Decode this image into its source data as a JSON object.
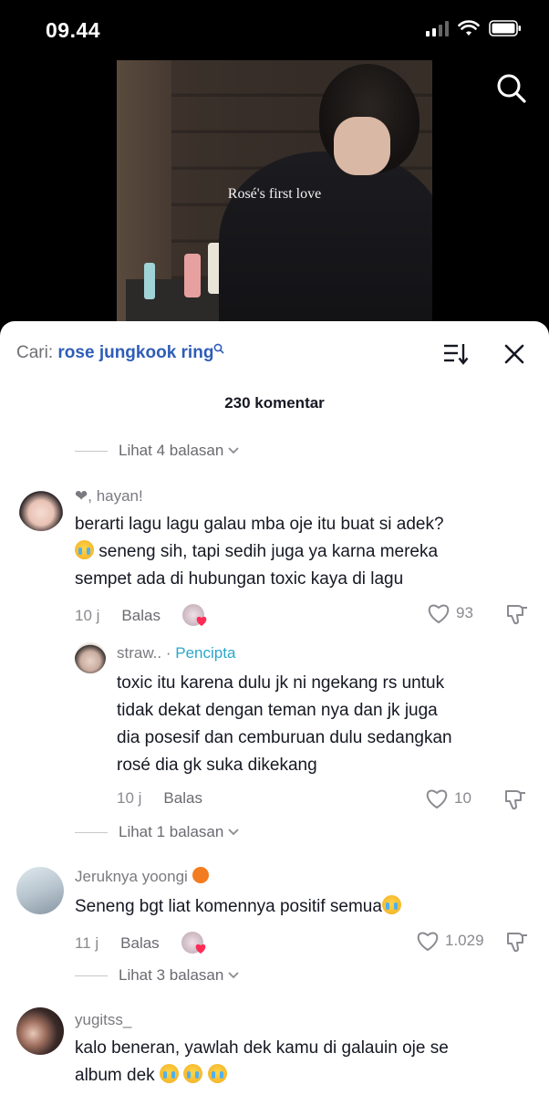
{
  "status_bar": {
    "time": "09.44"
  },
  "video": {
    "caption": "Rosé's first love"
  },
  "sheet": {
    "search_prefix": "Cari:",
    "search_query": "rose jungkook ring",
    "comment_count": "230 komentar"
  },
  "comments": [
    {
      "view_replies": "Lihat 4 balasan"
    },
    {
      "username": "❤︎, hayan!",
      "text_line1": "berarti lagu lagu galau mba oje itu buat si adek?",
      "text_line2": "seneng sih, tapi sedih juga ya karna mereka",
      "text_line3": "sempet ada di hubungan toxic kaya di lagu",
      "time": "10 j",
      "reply_label": "Balas",
      "likes": "93"
    },
    {
      "username": "straw..",
      "separator": "·",
      "badge": "Pencipta",
      "text_line1": "toxic itu karena dulu jk ni ngekang rs untuk",
      "text_line2": "tidak dekat dengan teman nya dan jk juga",
      "text_line3": "dia posesif dan cemburuan dulu sedangkan",
      "text_line4": "rosé dia gk suka dikekang",
      "time": "10 j",
      "reply_label": "Balas",
      "likes": "10",
      "view_replies": "Lihat 1 balasan"
    },
    {
      "username": "Jeruknya yoongi",
      "text": "Seneng bgt liat komennya positif semua",
      "time": "11 j",
      "reply_label": "Balas",
      "likes": "1.029",
      "view_replies": "Lihat 3 balasan"
    },
    {
      "username": "yugitss_",
      "text_line1": "kalo beneran, yawlah dek kamu di galauin oje se",
      "text_line2": "album dek"
    }
  ],
  "colors": {
    "accent_link": "#2f5db7",
    "creator_badge": "#2aa7c9",
    "text": "#161823",
    "muted": "#8a8a90"
  },
  "icons": [
    "search-icon",
    "sort-icon",
    "close-icon",
    "heart-icon",
    "dislike-icon",
    "chevron-down-icon",
    "crying-emoji-icon"
  ]
}
